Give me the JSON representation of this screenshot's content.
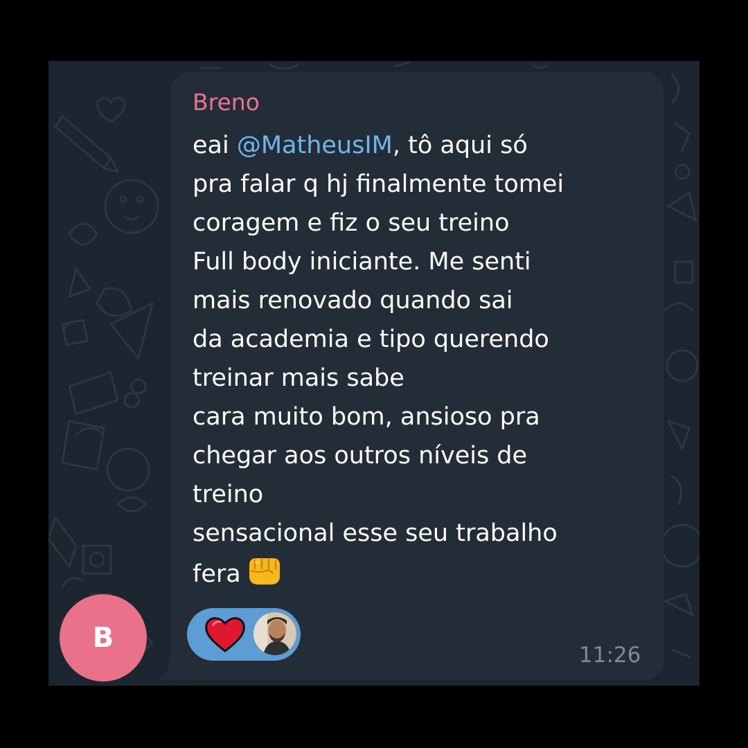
{
  "chat": {
    "sender_name": "Breno",
    "message_lines": [
      {
        "before": "eai ",
        "mention": "@MatheusIM",
        "after": ", tô aqui só"
      },
      {
        "text": "pra falar q hj finalmente tomei"
      },
      {
        "text": "coragem e fiz o seu treino"
      },
      {
        "text": "Full body iniciante. Me senti"
      },
      {
        "text": "mais renovado quando sai"
      },
      {
        "text": "da academia e tipo querendo"
      },
      {
        "text": "treinar mais sabe"
      },
      {
        "text": "cara muito bom, ansioso pra"
      },
      {
        "text": "chegar aos outros níveis de"
      },
      {
        "text": "treino"
      },
      {
        "text": "sensacional esse seu trabalho"
      },
      {
        "text": "fera",
        "emoji": "fist-emoji"
      }
    ],
    "timestamp": "11:26",
    "avatar_initial": "B",
    "reaction": {
      "emoji": "heart-emoji",
      "reactor": "reactor-avatar"
    }
  },
  "colors": {
    "background": "#000000",
    "chat_background": "#1b2630",
    "bubble": "#222d37",
    "sender_name": "#e8748f",
    "mention": "#6fb6ee",
    "message_text": "#ffffff",
    "timestamp": "#7f8a95",
    "avatar": "#e9728a",
    "reaction_pill": "#5c9ed4"
  }
}
